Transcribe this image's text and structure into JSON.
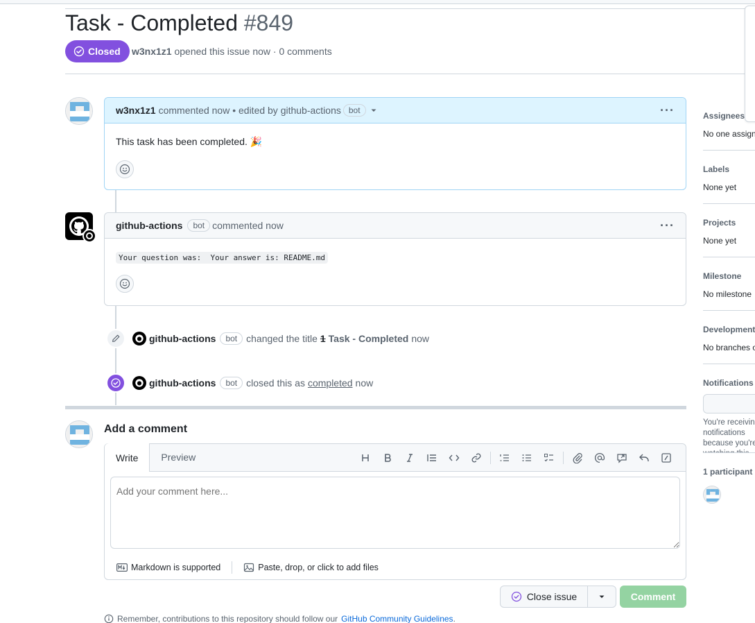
{
  "issue": {
    "title": "Task - Completed",
    "number": "#849",
    "state_label": "Closed",
    "author": "w3nx1z1",
    "meta_text": "opened this issue now · 0 comments"
  },
  "comments": [
    {
      "author": "w3nx1z1",
      "header_text": "commented now • edited by github-actions",
      "badge": "bot",
      "body": "This task has been completed. 🎉"
    },
    {
      "author": "github-actions",
      "badge": "bot",
      "header_text": "commented now",
      "body_code": "Your question was:  Your answer is: README.md"
    }
  ],
  "events": [
    {
      "actor": "github-actions",
      "badge": "bot",
      "action": "changed the title",
      "old_title": "1",
      "new_title": "Task - Completed",
      "time": "now"
    },
    {
      "actor": "github-actions",
      "badge": "bot",
      "action": "closed this as",
      "link": "completed",
      "time": "now"
    }
  ],
  "editor": {
    "heading": "Add a comment",
    "tab_write": "Write",
    "tab_preview": "Preview",
    "placeholder": "Add your comment here...",
    "markdown_note": "Markdown is supported",
    "attach_note": "Paste, drop, or click to add files"
  },
  "buttons": {
    "close_issue": "Close issue",
    "comment": "Comment"
  },
  "footer": {
    "remember_text": "Remember, contributions to this repository should follow our",
    "guidelines_link": "GitHub Community Guidelines",
    "period": "."
  },
  "sidebar": {
    "assignees_label": "Assignees",
    "assignees_value": "No one assigned",
    "labels_label": "Labels",
    "labels_value": "None yet",
    "projects_label": "Projects",
    "projects_value": "None yet",
    "milestone_label": "Milestone",
    "milestone_value": "No milestone",
    "development_label": "Development",
    "development_value": "No branches or pull requests",
    "notifications_label": "Notifications",
    "notifications_note": "You're receiving notifications because you're watching this thread.",
    "participants_label": "1 participant"
  },
  "colors": {
    "closed_purple": "#8250df",
    "owner_header_bg": "#ddf4ff",
    "comment_button_green": "#94d3a2",
    "link_blue": "#0969da"
  }
}
